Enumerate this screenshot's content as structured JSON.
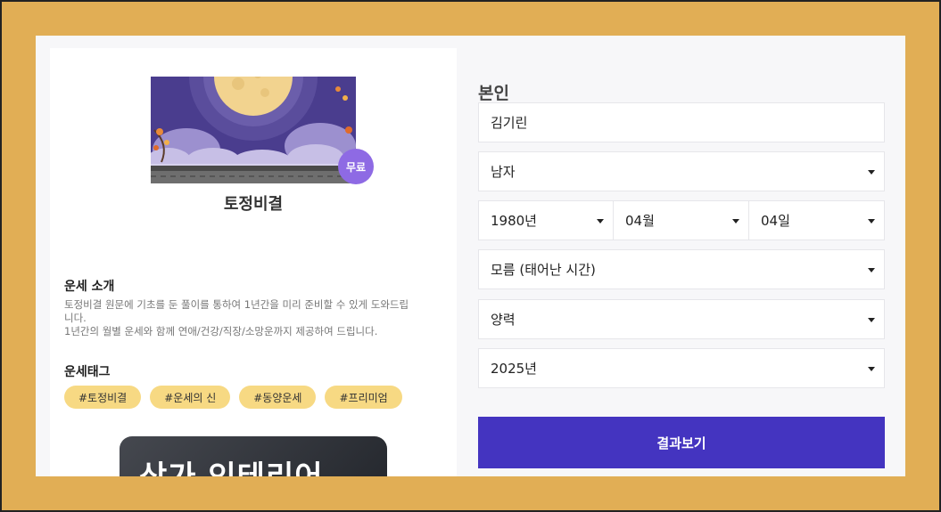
{
  "service": {
    "title": "토정비결",
    "badge": "무료",
    "intro_heading": "운세 소개",
    "intro_lines": [
      "토정비결 원문에 기초를 둔 풀이를 통하여 1년간을 미리 준비할 수 있게 도와드립",
      "니다.",
      "1년간의 월별 운세와 함께 연애/건강/직장/소망운까지 제공하여 드립니다."
    ],
    "tags_heading": "운세태그",
    "tags": [
      "#토정비결",
      "#운세의 신",
      "#동양운세",
      "#프리미엄"
    ],
    "ad_text": "상가 인테리어"
  },
  "form": {
    "person_label": "본인",
    "name_value": "김기린",
    "gender": "남자",
    "birth_year": "1980년",
    "birth_month": "04월",
    "birth_day": "04일",
    "birth_time": "모름 (태어난 시간)",
    "calendar": "양력",
    "target_year": "2025년",
    "submit_label": "결과보기"
  },
  "colors": {
    "background": "#e1ae55",
    "accent": "#4434c0",
    "badge": "#8e6ae4",
    "tag": "#f7d983"
  },
  "icons": [
    "moon-illustration",
    "dropdown-caret-icon"
  ]
}
